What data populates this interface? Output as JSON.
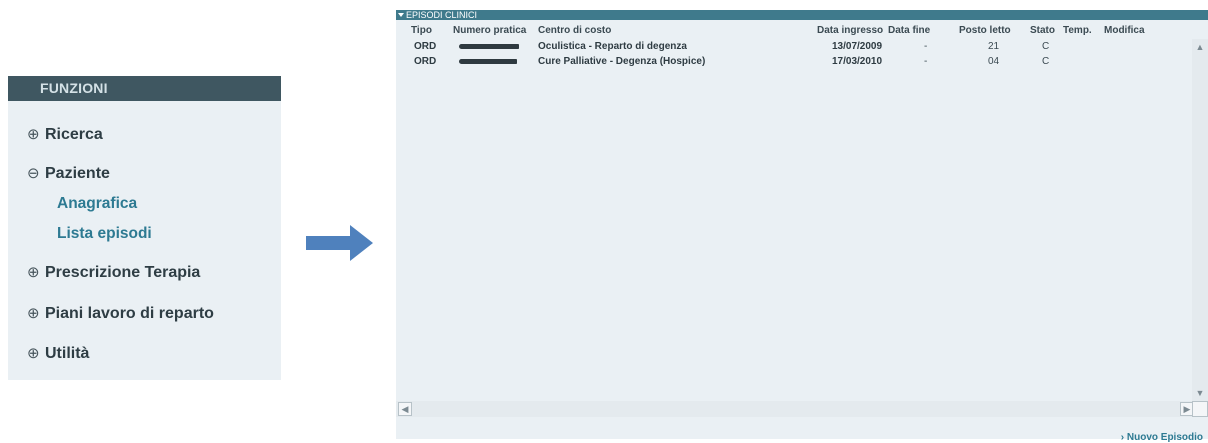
{
  "functions": {
    "title": "FUNZIONI",
    "groups": [
      {
        "symbol": "⊕",
        "label": "Ricerca"
      },
      {
        "symbol": "⊖",
        "label": "Paziente"
      },
      {
        "symbol": "⊕",
        "label": "Prescrizione Terapia"
      },
      {
        "symbol": "⊕",
        "label": "Piani lavoro di reparto"
      },
      {
        "symbol": "⊕",
        "label": "Utilità"
      }
    ],
    "paziente_items": [
      "Anagrafica",
      "Lista episodi"
    ]
  },
  "arrow": {
    "icon": "right-arrow-icon",
    "color": "#4f81bd"
  },
  "episodes": {
    "title": "EPISODI CLINICI",
    "columns": [
      "Tipo",
      "Numero pratica",
      "Centro di costo",
      "Data ingresso",
      "Data fine",
      "Posto letto",
      "Stato",
      "Temp.",
      "Modifica"
    ],
    "rows": [
      {
        "tipo": "ORD",
        "centro": "Oculistica - Reparto di degenza",
        "data_ingresso": "13/07/2009",
        "data_fine": "-",
        "posto_letto": "21",
        "stato": "C"
      },
      {
        "tipo": "ORD",
        "centro": "Cure Palliative - Degenza (Hospice)",
        "data_ingresso": "17/03/2010",
        "data_fine": "-",
        "posto_letto": "04",
        "stato": "C"
      }
    ],
    "new_episode": "Nuovo Episodio"
  },
  "colors": {
    "header_dark": "#3f5761",
    "header_teal": "#3f7a8c",
    "panel_bg": "#eaf0f4",
    "link": "#2d7a92"
  }
}
